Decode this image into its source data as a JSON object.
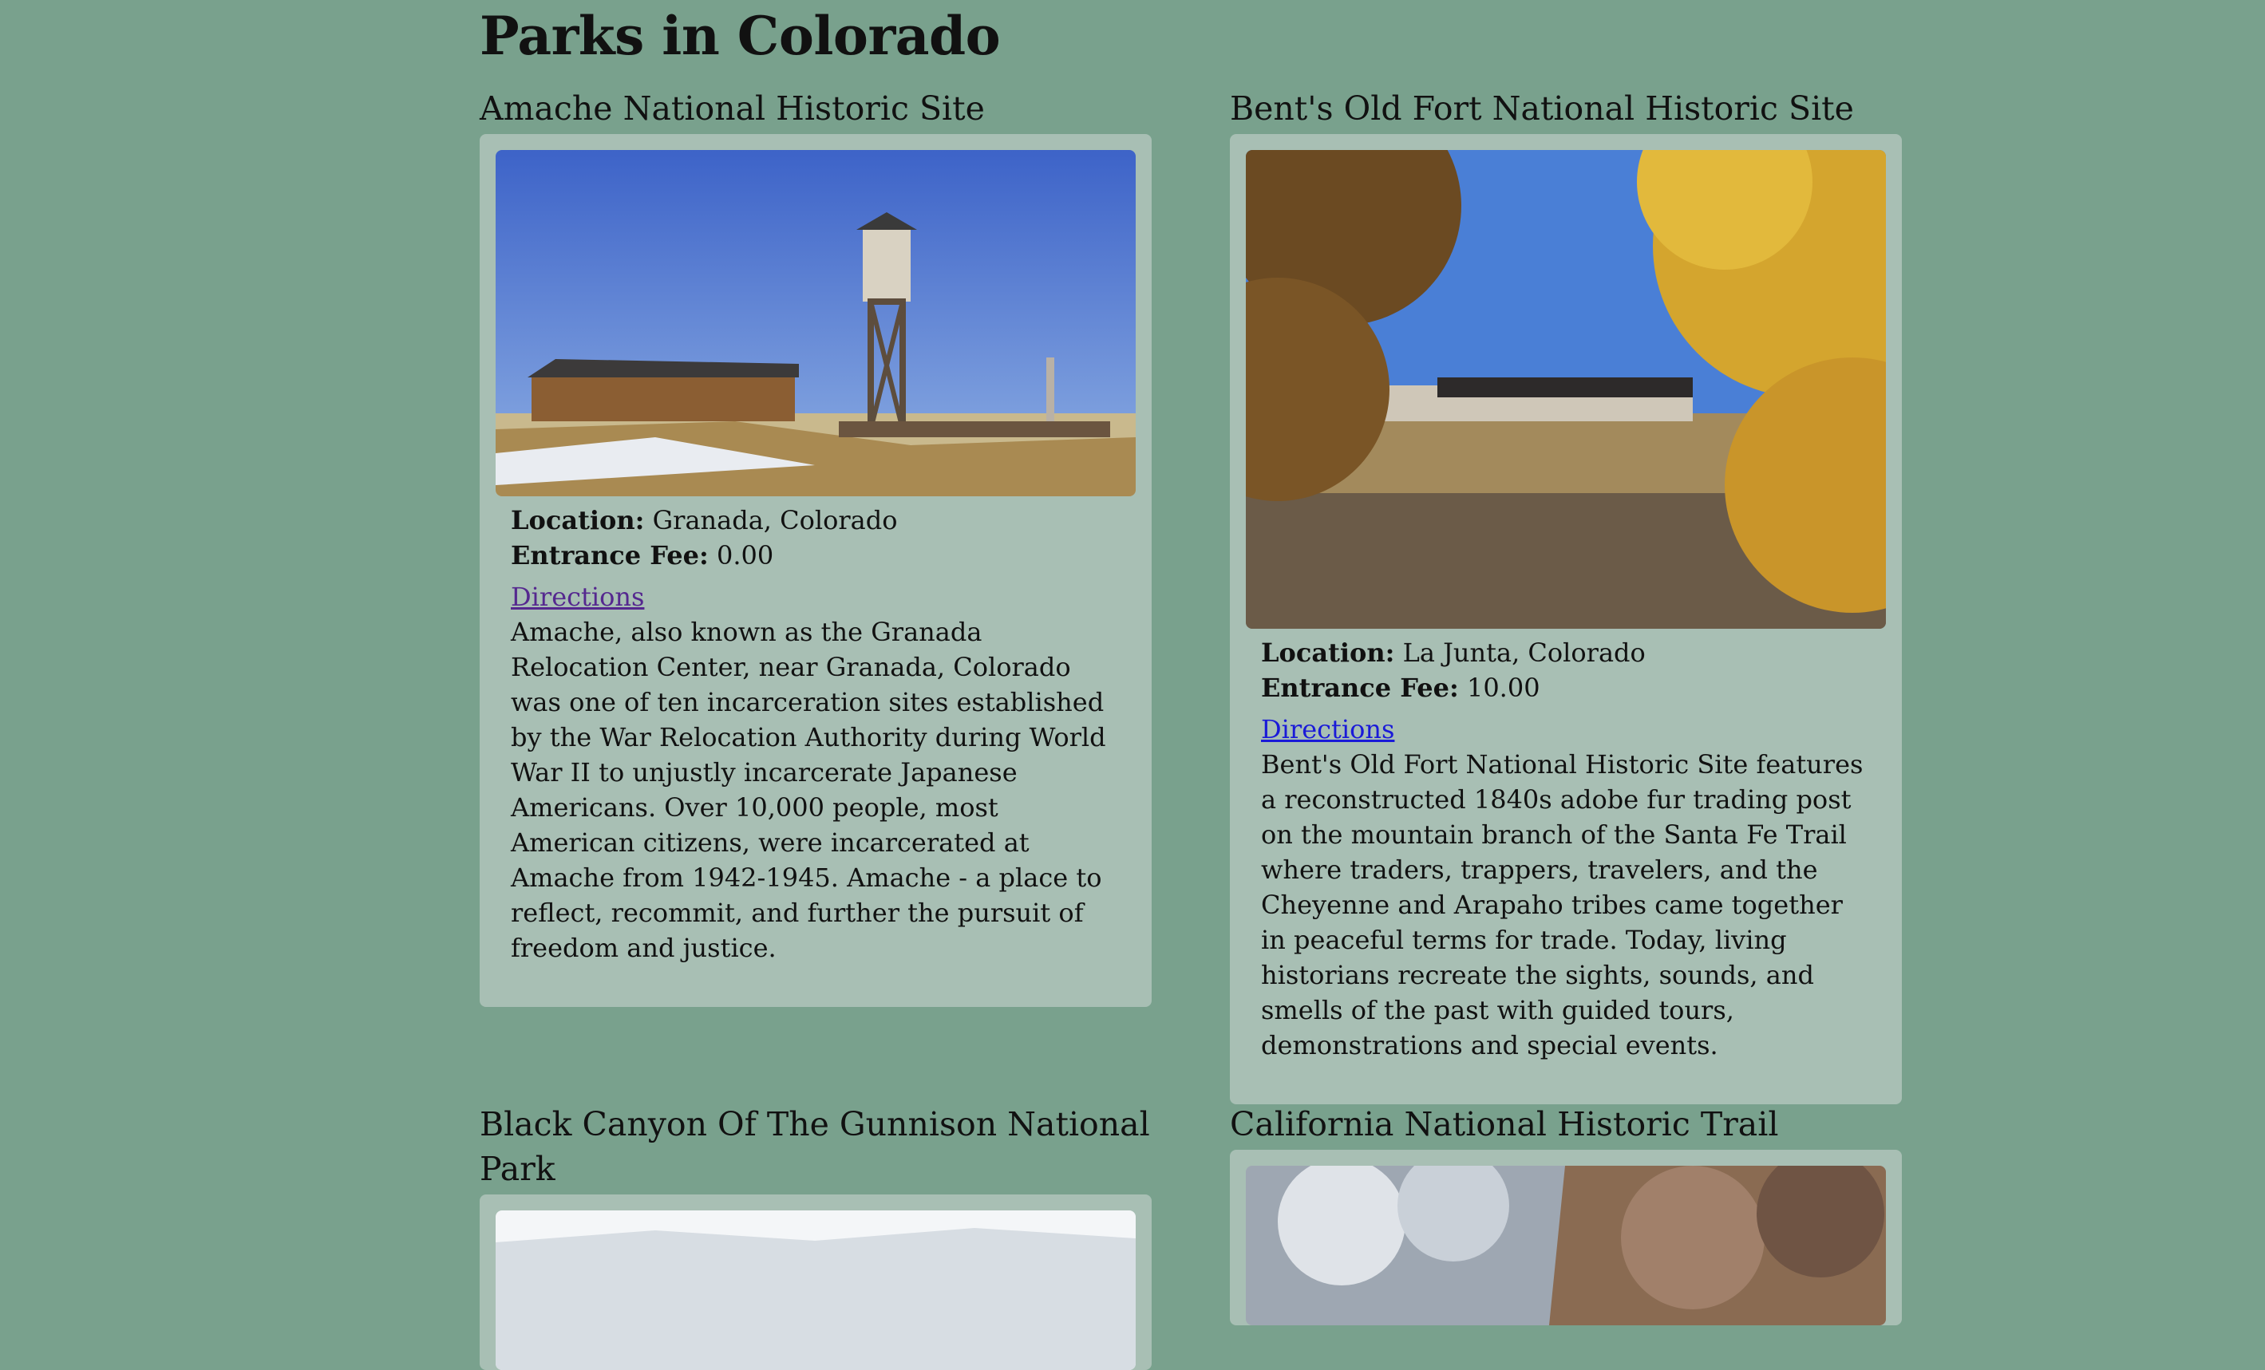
{
  "page_title": "Parks in Colorado",
  "parks": [
    {
      "name": "Amache National Historic Site",
      "location_label": "Location:",
      "location": "Granada, Colorado",
      "fee_label": "Entrance Fee:",
      "fee": "0.00",
      "directions": "Directions",
      "description": "Amache, also known as the Granada Relocation Center, near Granada, Colorado was one of ten incarceration sites established by the War Relocation Authority during World War II to unjustly incarcerate Japanese Americans. Over 10,000 people, most American citizens, were incarcerated at Amache from 1942-1945. Amache - a place to reflect, recommit, and further the pursuit of freedom and justice."
    },
    {
      "name": "Bent's Old Fort National Historic Site",
      "location_label": "Location:",
      "location": "La Junta, Colorado",
      "fee_label": "Entrance Fee:",
      "fee": "10.00",
      "directions": "Directions",
      "description": "Bent's Old Fort National Historic Site features a reconstructed 1840s adobe fur trading post on the mountain branch of the Santa Fe Trail where traders, trappers, travelers, and the Cheyenne and Arapaho tribes came together in peaceful terms for trade. Today, living historians recreate the sights, sounds, and smells of the past with guided tours, demonstrations and special events."
    },
    {
      "name": "Black Canyon Of The Gunnison National Park"
    },
    {
      "name": "California National Historic Trail"
    }
  ],
  "colors": {
    "page_background": "#79a18d",
    "card_background": "#a8bfb4",
    "link_visited": "#55288f",
    "link": "#1a1ad8"
  }
}
